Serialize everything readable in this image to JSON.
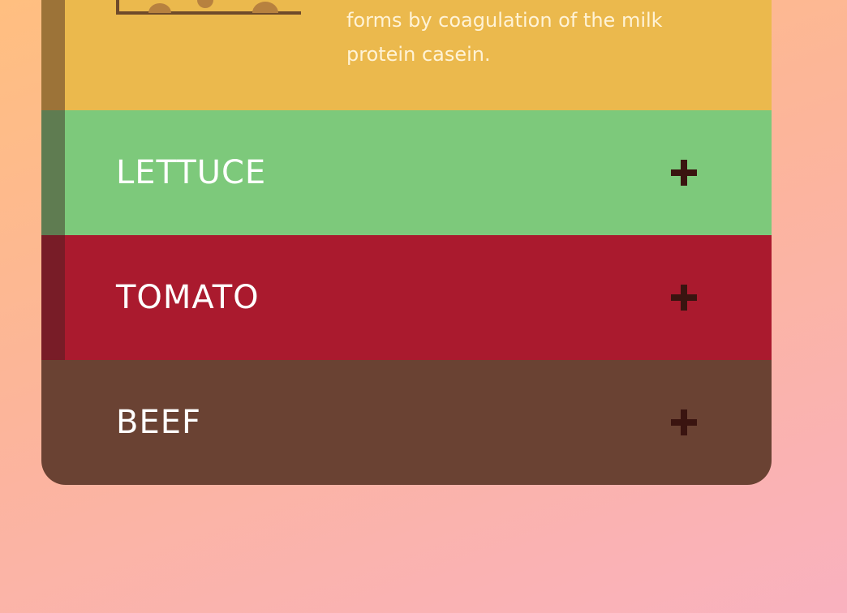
{
  "cheese": {
    "description": "forms by coagulation of the milk protein casein.",
    "icon": "cheese-icon"
  },
  "sections": [
    {
      "label": "LETTUCE",
      "color": "#7dc97b",
      "icon": "plus-icon"
    },
    {
      "label": "TOMATO",
      "color": "#aa1a2e",
      "icon": "plus-icon"
    },
    {
      "label": "BEEF",
      "color": "#6a4233",
      "icon": "plus-icon"
    }
  ],
  "colors": {
    "cheese": "#ebb94d",
    "plus": "#3a1410"
  }
}
